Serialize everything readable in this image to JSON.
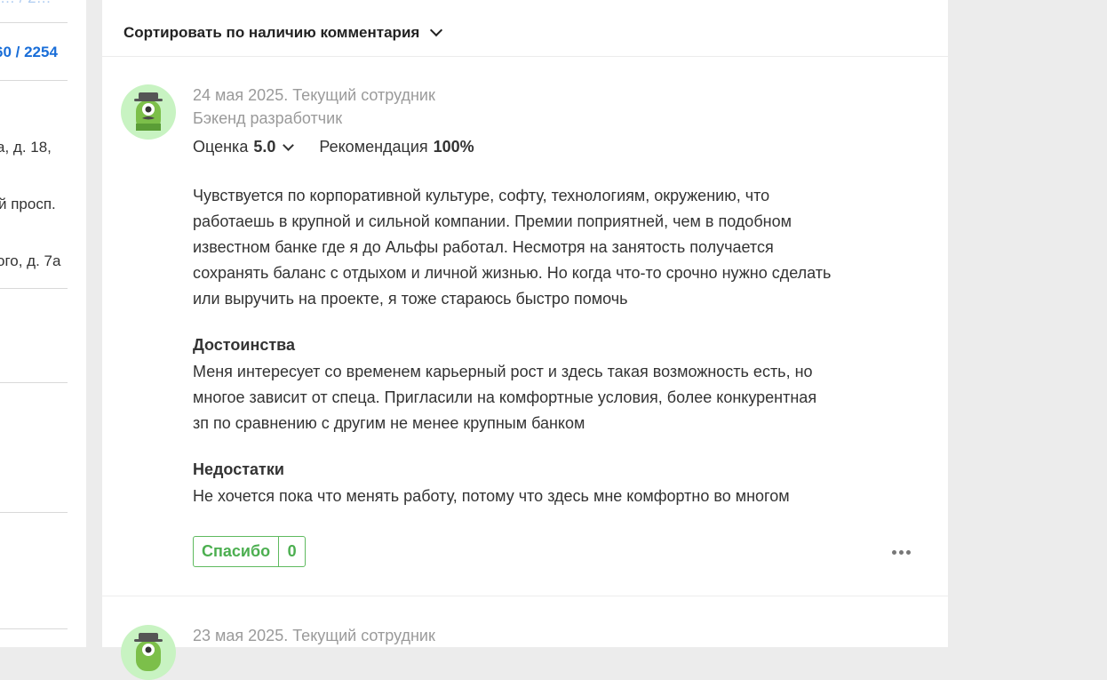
{
  "sidebar": {
    "items": [
      {
        "text": "60 / 2254"
      },
      {
        "text": "а, д. 18,"
      },
      {
        "text": "й просп."
      },
      {
        "text": "ого, д. 7а"
      }
    ]
  },
  "sort": {
    "label": "Сортировать по наличию комментария"
  },
  "review": {
    "date_status": "24 мая 2025. Текущий сотрудник",
    "position": "Бэкенд разработчик",
    "rating_label": "Оценка",
    "rating_value": "5.0",
    "recommend_label": "Рекомендация",
    "recommend_value": "100%",
    "text": "Чувствуется по корпоративной культуре, софту, технологиям, окружению, что работаешь в крупной и сильной компании. Премии поприятней, чем в подобном известном банке где я до Альфы работал. Несмотря на занятость получается сохранять баланс с отдыхом и личной жизнью. Но когда что-то срочно нужно сделать или выручить на проекте, я тоже стараюсь быстро помочь",
    "pros_title": "Достоинства",
    "pros_text": "Меня интересует со временем карьерный рост и здесь такая возможность есть, но многое зависит от спеца. Пригласили на комфортные условия, более конкурентная зп по сравнению с другим не менее крупным банком",
    "cons_title": "Недостатки",
    "cons_text": "Не хочется пока что менять работу, потому что здесь мне комфортно во многом",
    "thanks_label": "Спасибо",
    "thanks_count": "0"
  },
  "next_review": {
    "date_status": "23 мая 2025. Текущий сотрудник"
  }
}
